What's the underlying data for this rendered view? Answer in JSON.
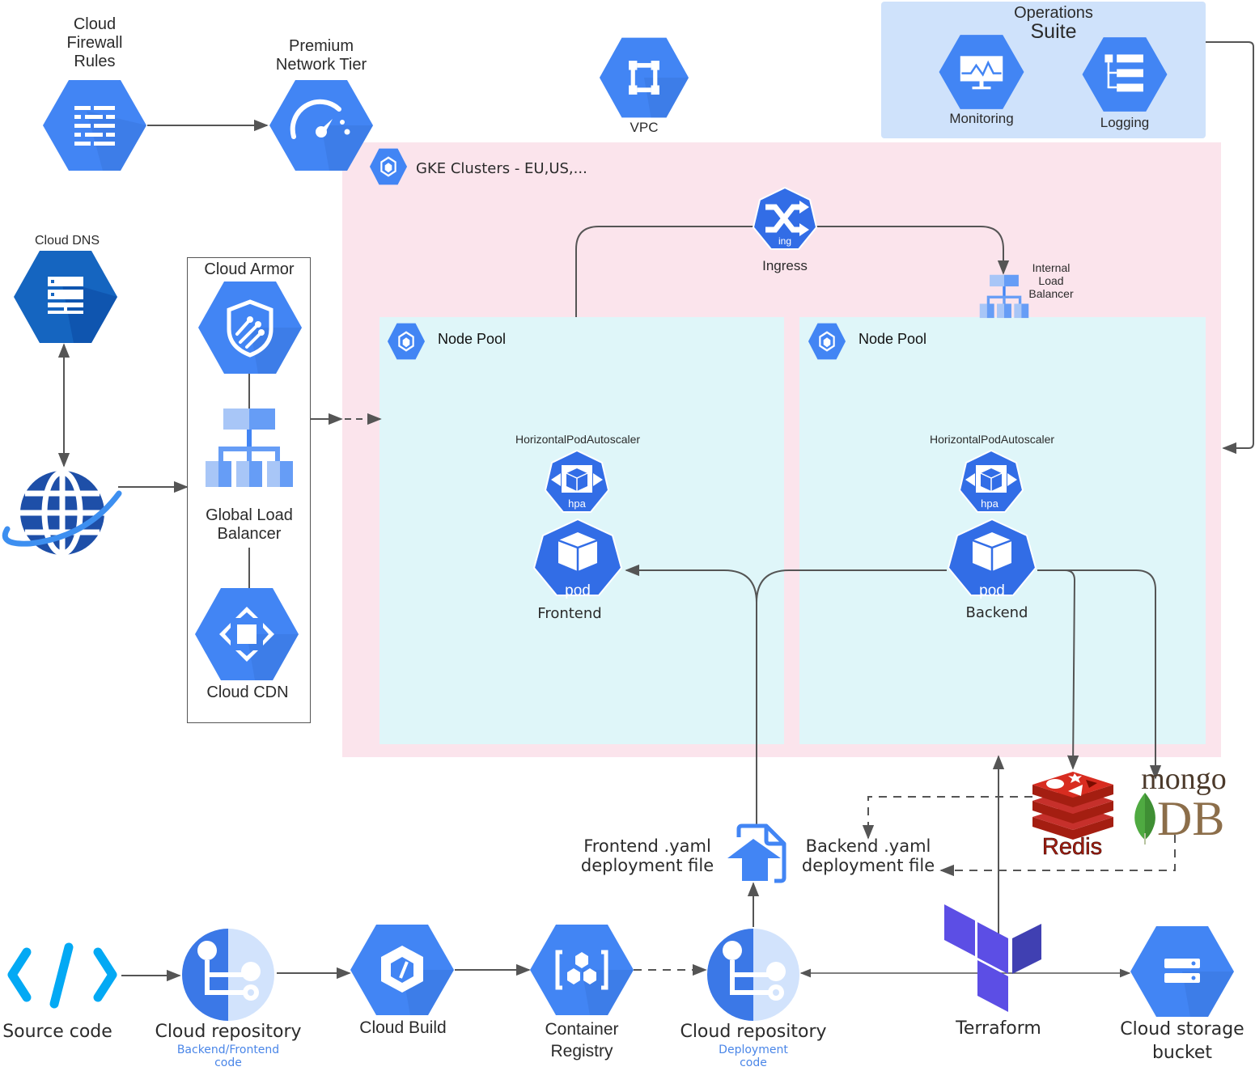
{
  "diagram": {
    "colors": {
      "gcp_blue": "#4285f4",
      "gcp_blue_dark": "#3a78e0",
      "k8s_blue": "#326de6",
      "dns_blue": "#1565c0",
      "ops_panel": "#cfe2fb",
      "gke_panel": "#fbe4ec",
      "node_pool_panel": "#dff6f9",
      "connector": "#555555",
      "redis_red": "#c6302b",
      "mongo_green": "#4faa41",
      "mongo_brown": "#8c6e4a",
      "terraform_purple": "#5c4ee5",
      "source_code_cyan": "#03a9f4",
      "sub_label_blue": "#4a86e8"
    },
    "top": {
      "firewall": {
        "label": "Cloud Firewall Rules",
        "lines": [
          "Cloud",
          "Firewall",
          "Rules"
        ],
        "icon": "firewall-icon"
      },
      "premium_network": {
        "lines": [
          "Premium",
          "Network Tier"
        ],
        "icon": "speedometer-icon"
      },
      "vpc": {
        "label": "VPC",
        "icon": "vpc-icon"
      }
    },
    "operations_suite": {
      "title_line1": "Operations",
      "title_line2": "Suite",
      "monitoring": {
        "label": "Monitoring",
        "icon": "monitoring-icon"
      },
      "logging": {
        "label": "Logging",
        "icon": "logging-icon"
      }
    },
    "left": {
      "cloud_dns": {
        "label": "Cloud DNS",
        "icon": "dns-server-icon"
      },
      "internet": {
        "icon": "globe-icon"
      },
      "cloud_armor_group": {
        "title": "Cloud Armor",
        "armor_icon": "shield-icon",
        "global_lb": {
          "lines": [
            "Global Load",
            "Balancer"
          ],
          "icon": "load-balancer-icon"
        },
        "cdn": {
          "label": "Cloud CDN",
          "icon": "cdn-icon"
        }
      }
    },
    "gke": {
      "title": "GKE Clusters - EU,US,...",
      "ingress": {
        "label": "Ingress",
        "badge": "ing"
      },
      "internal_lb": {
        "lines": [
          "Internal",
          "Load",
          "Balancer"
        ]
      },
      "node_pools": [
        {
          "title": "Node Pool",
          "hpa_label": "HorizontalPodAutoscaler",
          "hpa_badge": "hpa",
          "pod_badge": "pod",
          "pod_label": "Frontend"
        },
        {
          "title": "Node Pool",
          "hpa_label": "HorizontalPodAutoscaler",
          "hpa_badge": "hpa",
          "pod_badge": "pod",
          "pod_label": "Backend"
        }
      ]
    },
    "data_stores": {
      "redis": {
        "label": "Redis"
      },
      "mongodb": {
        "word1": "mongo",
        "word2": "DB"
      }
    },
    "deployment_files": {
      "frontend": {
        "lines": [
          "Frontend .yaml",
          "deployment file"
        ]
      },
      "backend": {
        "lines": [
          "Backend .yaml",
          "deployment file"
        ]
      }
    },
    "pipeline": [
      {
        "label": "Source code",
        "icon": "code-brackets-icon"
      },
      {
        "label": "Cloud repository",
        "sub": [
          "Backend/Frontend",
          "code"
        ],
        "icon": "repository-icon"
      },
      {
        "label": "Cloud Build",
        "icon": "build-icon"
      },
      {
        "lines": [
          "Container",
          "Registry"
        ],
        "icon": "container-registry-icon"
      },
      {
        "label": "Cloud repository",
        "sub": [
          "Deployment",
          "code"
        ],
        "icon": "repository-icon"
      },
      {
        "label": "Terraform",
        "icon": "terraform-icon"
      },
      {
        "lines": [
          "Cloud storage",
          "bucket"
        ],
        "icon": "storage-icon"
      }
    ]
  }
}
